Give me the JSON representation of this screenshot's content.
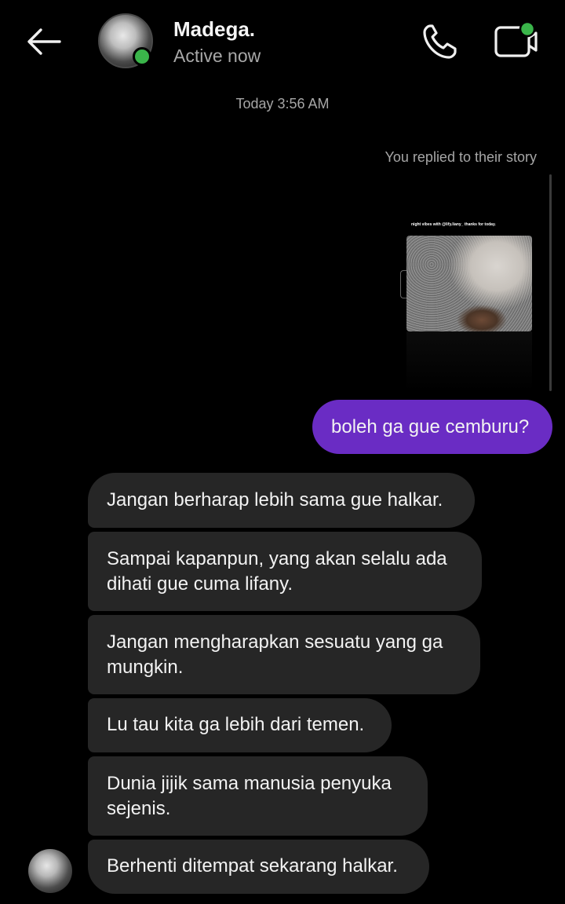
{
  "header": {
    "contact_name": "Madega.",
    "status": "Active now",
    "icons": {
      "back": "arrow-left-icon",
      "call": "phone-icon",
      "video": "video-camera-icon"
    },
    "online_indicator_color": "#3ab54a"
  },
  "thread": {
    "timestamp": "Today 3:56 AM",
    "story_reply_note": "You replied to their story",
    "story_caption": "night vibes with @lify.liany_ thanks for today.",
    "messages": [
      {
        "direction": "outgoing",
        "text": "boleh ga gue cemburu?"
      },
      {
        "direction": "incoming",
        "text_lines": [
          "Jangan berharap lebih sama gue halkar."
        ]
      },
      {
        "direction": "incoming",
        "text_lines": [
          "Sampai kapanpun, yang akan selalu ada",
          "dihati gue cuma lifany."
        ]
      },
      {
        "direction": "incoming",
        "text_lines": [
          "Jangan mengharapkan sesuatu yang ga",
          "mungkin."
        ]
      },
      {
        "direction": "incoming",
        "text_lines": [
          "Lu tau kita ga lebih dari temen."
        ]
      },
      {
        "direction": "incoming",
        "text_lines": [
          "Dunia jijik sama manusia penyuka",
          "sejenis."
        ]
      },
      {
        "direction": "incoming",
        "text_lines": [
          "Berhenti ditempat sekarang halkar."
        ]
      }
    ]
  },
  "colors": {
    "background": "#000000",
    "outgoing_bubble": "#6a2cc4",
    "incoming_bubble": "#262626",
    "secondary_text": "#a6a6a6"
  }
}
